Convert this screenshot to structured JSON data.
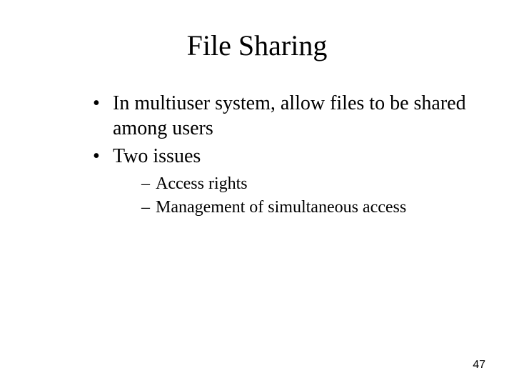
{
  "title": "File Sharing",
  "bullets": [
    {
      "text": "In multiuser system, allow files to be shared among users"
    },
    {
      "text": "Two issues",
      "sub": [
        "Access rights",
        "Management of simultaneous access"
      ]
    }
  ],
  "page_number": "47"
}
